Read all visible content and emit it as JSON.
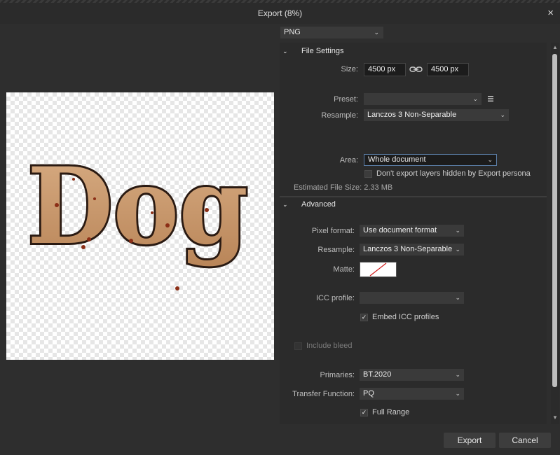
{
  "window": {
    "title": "Export (8%)",
    "close_icon": "×"
  },
  "preview": {
    "text": "Dog"
  },
  "format": {
    "value": "PNG"
  },
  "file_settings": {
    "header": "File Settings",
    "size_label": "Size:",
    "width": "4500 px",
    "height": "4500 px",
    "preset_label": "Preset:",
    "preset_value": "",
    "resample_label": "Resample:",
    "resample_value": "Lanczos 3 Non-Separable",
    "area_label": "Area:",
    "area_value": "Whole document",
    "hidden_layers_label": "Don't export layers hidden by Export persona",
    "estimated_size": "Estimated File Size: 2.33 MB"
  },
  "advanced": {
    "header": "Advanced",
    "pixel_format_label": "Pixel format:",
    "pixel_format_value": "Use document format",
    "resample_label": "Resample:",
    "resample_value": "Lanczos 3 Non-Separable",
    "matte_label": "Matte:",
    "icc_label": "ICC profile:",
    "icc_value": "",
    "embed_icc_label": "Embed ICC profiles",
    "embed_icc_checked": true,
    "include_bleed_label": "Include bleed",
    "include_bleed_checked": false,
    "primaries_label": "Primaries:",
    "primaries_value": "BT.2020",
    "transfer_label": "Transfer Function:",
    "transfer_value": "PQ",
    "full_range_label": "Full Range",
    "full_range_checked": true
  },
  "buttons": {
    "export": "Export",
    "cancel": "Cancel"
  },
  "colors": {
    "paw_print": "#8b2e16",
    "letter_fill": "#c99a70",
    "letter_outline": "#2a1a12"
  }
}
